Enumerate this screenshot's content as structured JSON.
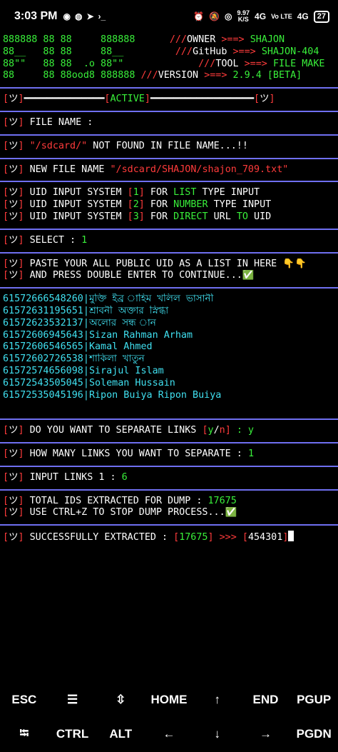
{
  "status_bar": {
    "time": "3:03 PM",
    "net_speed": "9.97",
    "net_unit": "K/S",
    "net1": "4G",
    "net2": "Vo LTE",
    "net3": "4G",
    "battery": "27"
  },
  "banner": {
    "left": [
      "888888 88 88     888888",
      "88__   88 88     88__",
      "88\"\"   88 88  .o 88\"\"",
      "88     88 88ood8 888888"
    ],
    "right": [
      {
        "prefix": "///",
        "label": "OWNER",
        "arrow": ">==>",
        "value": "SHAJON"
      },
      {
        "prefix": "///",
        "label": "GitHub",
        "arrow": ">==>",
        "value": "SHAJON-404"
      },
      {
        "prefix": "///",
        "label": "TOOL",
        "arrow": ">==>",
        "value": "FILE MAKE"
      },
      {
        "prefix": "///",
        "label": "VERSION",
        "arrow": ">==>",
        "value": "2.9.4 [BETA]"
      }
    ]
  },
  "tag": "ツ",
  "active_label": "ACTIVE",
  "lines": {
    "file_name": "FILE NAME :",
    "not_found_path": "\"/sdcard/\"",
    "not_found_text": "NOT FOUND IN FILE NAME...!!",
    "new_file_label": "NEW FILE NAME",
    "new_file_path": "\"/sdcard/SHAJON/shajon_709.txt\"",
    "uid_menu": [
      {
        "num": "1",
        "kw": "LIST",
        "rest": "TYPE INPUT"
      },
      {
        "num": "2",
        "kw": "NUMBER",
        "rest": "TYPE INPUT"
      },
      {
        "num": "3",
        "kw": "DIRECT",
        "rest": "URL",
        "kw2": "TO",
        "rest2": "UID"
      }
    ],
    "uid_prefix": "UID INPUT SYSTEM",
    "uid_for": "FOR",
    "select_label": "SELECT :",
    "select_value": "1",
    "paste1": "PASTE YOUR ALL PUBLIC UID AS A LIST IN HERE 👇👇",
    "paste2": "AND PRESS DOUBLE ENTER TO CONTINUE...✅",
    "separate_q": "DO YOU WANT TO SEPARATE LINKS",
    "separate_opts_y": "y",
    "separate_opts_n": "n",
    "separate_ans": ": y",
    "how_many": "HOW MANY LINKS YOU WANT TO SEPARATE :",
    "how_many_val": "1",
    "input_links": "INPUT LINKS 1 :",
    "input_links_val": "6",
    "total_ids": "TOTAL IDS EXTRACTED FOR DUMP :",
    "total_ids_val": "17675",
    "ctrlz": "USE CTRL+Z TO STOP DUMP PROCESS...✅",
    "success": "SUCCESSFULLY EXTRACTED :",
    "success_count": "17675",
    "success_arrow": ">>>",
    "success_last": "454301"
  },
  "uid_list": [
    {
      "uid": "61572666548260",
      "name": "মুক্তি ইব্র াহিম খলিল ভাসানী"
    },
    {
      "uid": "61572631195651",
      "name": "শ্রাবনী অক্তার স্নিগ্ধা"
    },
    {
      "uid": "61572623532137",
      "name": "অলোর সন্ধ ান"
    },
    {
      "uid": "61572606945643",
      "name": "Sizan Rahman Arham"
    },
    {
      "uid": "61572606546565",
      "name": "Kamal Ahmed"
    },
    {
      "uid": "61572602726538",
      "name": "শাকিলা খাতুন"
    },
    {
      "uid": "61572574656098",
      "name": "Sirajul Islam"
    },
    {
      "uid": "61572543505045",
      "name": "Soleman Hussain"
    },
    {
      "uid": "61572535045196",
      "name": "Ripon Buiya Ripon Buiya"
    }
  ],
  "keys": {
    "row1": [
      "ESC",
      "☰",
      "⇳",
      "HOME",
      "↑",
      "END",
      "PGUP"
    ],
    "row2": [
      "⭾",
      "CTRL",
      "ALT",
      "←",
      "↓",
      "→",
      "PGDN"
    ]
  }
}
